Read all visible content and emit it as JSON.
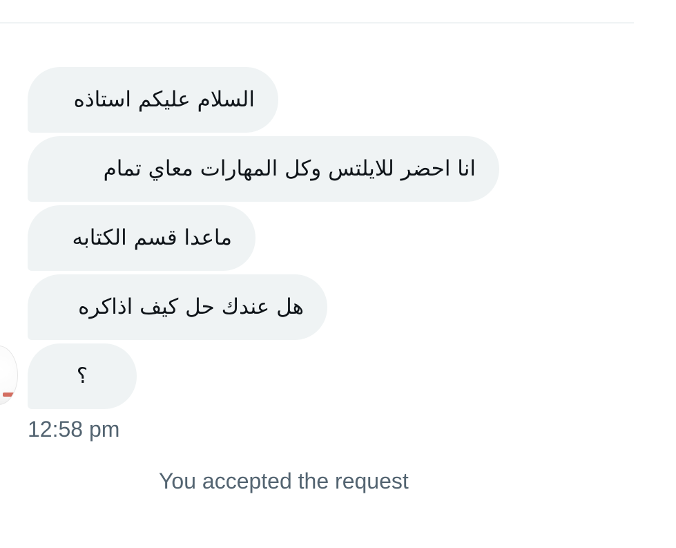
{
  "conversation": {
    "messages": [
      {
        "text": "السلام عليكم استاذه"
      },
      {
        "text": "انا احضر للايلتس وكل المهارات معاي تمام"
      },
      {
        "text": "ماعدا قسم الكتابه"
      },
      {
        "text": "هل عندك حل كيف اذاكره"
      },
      {
        "text": "؟"
      }
    ],
    "timestamp": "12:58 pm",
    "system_message": "You accepted the request"
  },
  "colors": {
    "bubble_bg": "#eff3f4",
    "text_primary": "#0f1419",
    "text_secondary": "#536471",
    "avatar_accent": "#c94a3a"
  },
  "icons": {
    "avatar": "sender-avatar-icon"
  }
}
